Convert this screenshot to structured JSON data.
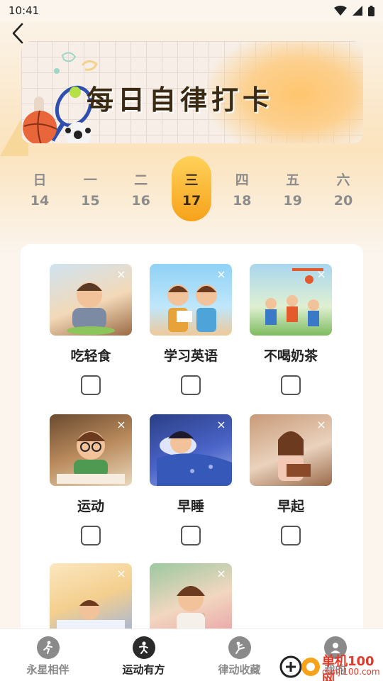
{
  "status_bar": {
    "time": "10:41"
  },
  "banner": {
    "title": "每日自律打卡"
  },
  "week": [
    {
      "name": "日",
      "date": "14",
      "active": false
    },
    {
      "name": "一",
      "date": "15",
      "active": false
    },
    {
      "name": "二",
      "date": "16",
      "active": false
    },
    {
      "name": "三",
      "date": "17",
      "active": true
    },
    {
      "name": "四",
      "date": "18",
      "active": false
    },
    {
      "name": "五",
      "date": "19",
      "active": false
    },
    {
      "name": "六",
      "date": "20",
      "active": false
    }
  ],
  "tasks": [
    {
      "label": "吃轻食",
      "checked": false
    },
    {
      "label": "学习英语",
      "checked": false
    },
    {
      "label": "不喝奶茶",
      "checked": false
    },
    {
      "label": "运动",
      "checked": false
    },
    {
      "label": "早睡",
      "checked": false
    },
    {
      "label": "早起",
      "checked": false
    },
    {
      "label": "",
      "checked": false
    },
    {
      "label": "",
      "checked": false
    }
  ],
  "remove_glyph": "×",
  "tabbar": {
    "items": [
      {
        "label": "永星相伴",
        "icon": "person-run-icon",
        "active": false
      },
      {
        "label": "运动有方",
        "icon": "person-exercise-icon",
        "active": true
      },
      {
        "label": "律动收藏",
        "icon": "person-kick-icon",
        "active": false
      },
      {
        "label": "我的",
        "icon": "user-profile-icon",
        "active": false
      }
    ]
  },
  "watermark": {
    "line1": "单机100网",
    "line2": "danji100.com"
  },
  "colors": {
    "accent": "#f6a21a",
    "accent_light": "#ffd25a",
    "background": "#fbf5ee"
  }
}
